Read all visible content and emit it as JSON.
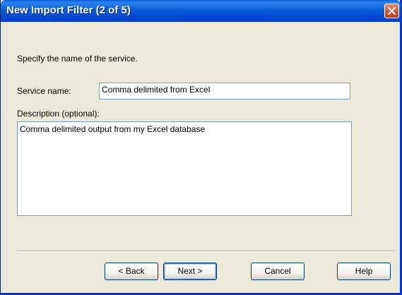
{
  "window": {
    "title": "New Import Filter (2 of 5)",
    "close_icon": "close-icon"
  },
  "content": {
    "instruction": "Specify the name of the service.",
    "service_name_label": "Service name:",
    "service_name_value": "Comma delimited from Excel",
    "description_label": "Description (optional):",
    "description_value": "Comma delimited output from my Excel database"
  },
  "buttons": {
    "back": "< Back",
    "next": "Next >",
    "cancel": "Cancel",
    "help": "Help"
  },
  "colors": {
    "titlebar": "#0a5fd8",
    "dialog_background": "#ece9d8",
    "close_button": "#d95636"
  }
}
